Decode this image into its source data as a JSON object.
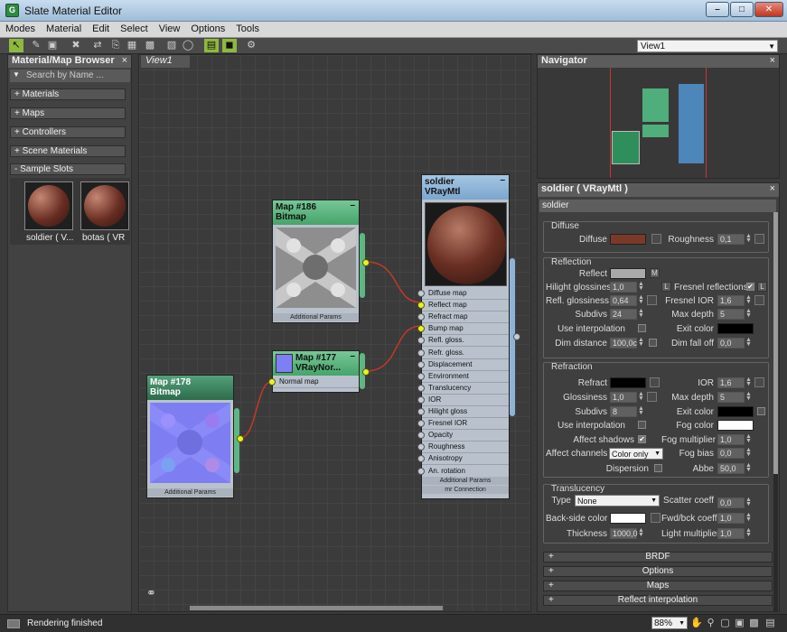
{
  "window": {
    "title": "Slate Material Editor",
    "app_icon": "3ds-max-icon"
  },
  "menu": [
    "Modes",
    "Material",
    "Edit",
    "Select",
    "View",
    "Options",
    "Tools"
  ],
  "toolbar": {
    "view_selector": "View1"
  },
  "browser": {
    "title": "Material/Map Browser",
    "search_placeholder": "Search by Name ...",
    "rollouts": [
      "+ Materials",
      "+ Maps",
      "+ Controllers",
      "+ Scene Materials",
      "- Sample Slots"
    ],
    "slots": [
      "soldier  ( V...",
      "botas  ( VR"
    ]
  },
  "view": {
    "tab": "View1"
  },
  "nodes": {
    "map186": {
      "line1": "Map #186",
      "line2": "Bitmap",
      "footer": "Additional Params"
    },
    "map177": {
      "line1": "Map #177",
      "line2": "VRayNor...",
      "slot": "Normal map"
    },
    "map178": {
      "line1": "Map #178",
      "line2": "Bitmap",
      "footer": "Additional Params"
    },
    "soldier": {
      "line1": "soldier",
      "line2": "VRayMtl",
      "slots": [
        "Diffuse map",
        "Reflect map",
        "Refract map",
        "Bump map",
        "Refl. gloss.",
        "Refr. gloss.",
        "Displacement",
        "Environment",
        "Translucency",
        "IOR",
        "Hilight gloss",
        "Fresnel IOR",
        "Opacity",
        "Roughness",
        "Anisotropy",
        "An. rotation"
      ],
      "connected": [
        1,
        3
      ],
      "footers": [
        "Additional Params",
        "mr Connection"
      ]
    }
  },
  "navigator": {
    "title": "Navigator"
  },
  "properties": {
    "title": "soldier  ( VRayMtl )",
    "name": "soldier",
    "diffuse": {
      "title": "Diffuse",
      "diffuse_label": "Diffuse",
      "diffuse_color": "#7a3a2a",
      "roughness_label": "Roughness",
      "roughness": "0,1"
    },
    "reflection": {
      "title": "Reflection",
      "reflect_label": "Reflect",
      "reflect_color": "#a9a9a9",
      "m_label": "M",
      "hilight_label": "Hilight glossiness",
      "hilight": "1,0",
      "l1": "L",
      "fresnel_label": "Fresnel reflections",
      "l2": "L",
      "refl_gloss_label": "Refl. glossiness",
      "refl_gloss": "0,64",
      "fresnel_ior_label": "Fresnel IOR",
      "fresnel_ior": "1,6",
      "subdivs_label": "Subdivs",
      "subdivs": "24",
      "max_depth_label": "Max depth",
      "max_depth": "5",
      "use_interp_label": "Use interpolation",
      "exit_color_label": "Exit color",
      "dim_dist_label": "Dim distance",
      "dim_dist": "100,0c",
      "dim_falloff_label": "Dim fall off",
      "dim_falloff": "0,0"
    },
    "refraction": {
      "title": "Refraction",
      "refract_label": "Refract",
      "refract_color": "#000000",
      "ior_label": "IOR",
      "ior": "1,6",
      "gloss_label": "Glossiness",
      "gloss": "1,0",
      "max_depth_label": "Max depth",
      "max_depth": "5",
      "subdivs_label": "Subdivs",
      "subdivs": "8",
      "exit_color_label": "Exit color",
      "use_interp_label": "Use interpolation",
      "fog_color_label": "Fog color",
      "fog_color": "#ffffff",
      "affect_shadows_label": "Affect shadows",
      "affect_shadows": "✔",
      "fog_mult_label": "Fog multiplier",
      "fog_mult": "1,0",
      "affect_channels_label": "Affect channels",
      "affect_channels": "Color only",
      "fog_bias_label": "Fog bias",
      "fog_bias": "0,0",
      "dispersion_label": "Dispersion",
      "abbe_label": "Abbe",
      "abbe": "50,0"
    },
    "translucency": {
      "title": "Translucency",
      "type_label": "Type",
      "type": "None",
      "scatter_label": "Scatter coeff",
      "scatter": "0,0",
      "backside_label": "Back-side color",
      "backside_color": "#ffffff",
      "fwd_label": "Fwd/bck coeff",
      "fwd": "1,0",
      "thickness_label": "Thickness",
      "thickness": "1000,0",
      "light_mult_label": "Light multiplier",
      "light_mult": "1,0"
    },
    "rollouts": [
      "BRDF",
      "Options",
      "Maps",
      "Reflect interpolation"
    ],
    "rollout_plus": "+"
  },
  "status": {
    "message": "Rendering finished",
    "zoom": "88%"
  },
  "colors": {
    "panel_bg": "#3f3f3f",
    "accent_green": "#8fb840",
    "node_green": "#5fb682",
    "node_blue": "#8fb3d6",
    "wire": "#c0392b"
  }
}
